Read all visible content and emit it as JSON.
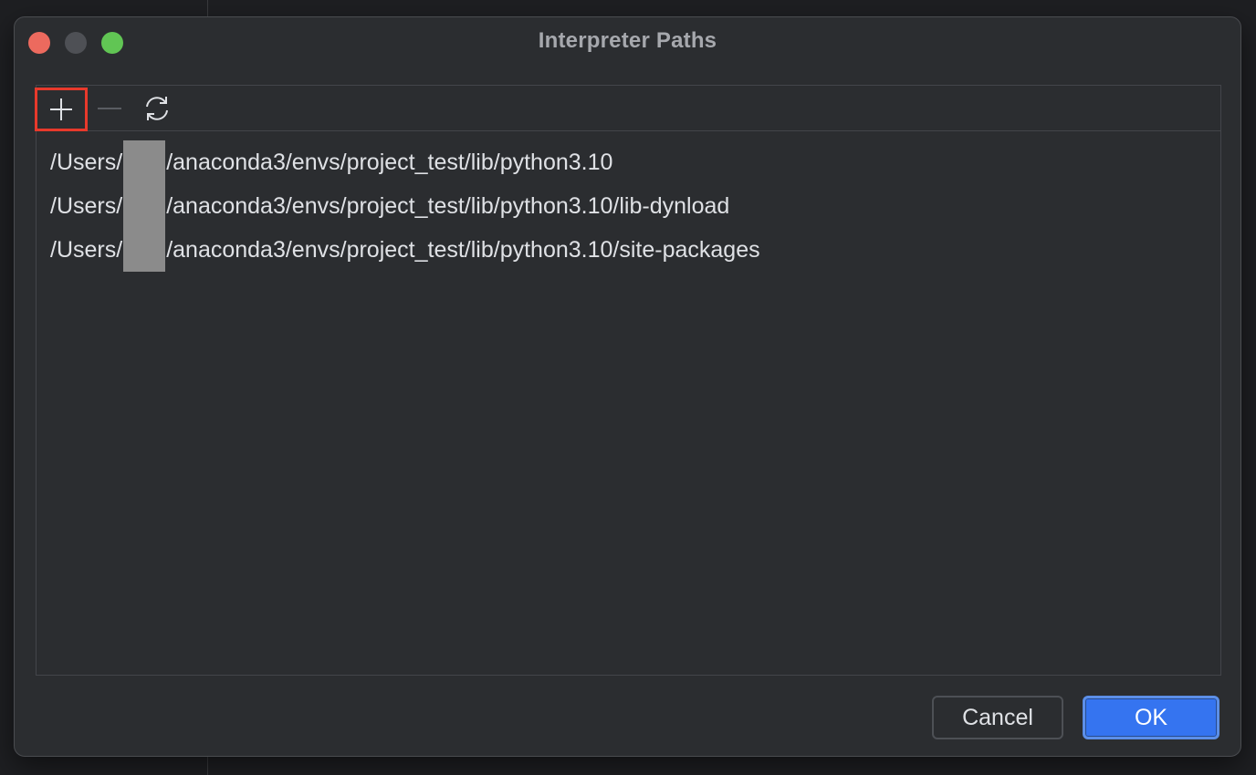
{
  "dialog": {
    "title": "Interpreter Paths"
  },
  "toolbar": {
    "add_icon": "plus-icon",
    "remove_icon": "minus-icon",
    "reload_icon": "reload-icon",
    "highlight_color": "#e8392b"
  },
  "paths": [
    {
      "prefix": "/Users/",
      "suffix": "/anaconda3/envs/project_test/lib/python3.10"
    },
    {
      "prefix": "/Users/",
      "suffix": "/anaconda3/envs/project_test/lib/python3.10/lib-dynload"
    },
    {
      "prefix": "/Users/",
      "suffix": "/anaconda3/envs/project_test/lib/python3.10/site-packages"
    }
  ],
  "buttons": {
    "cancel_label": "Cancel",
    "ok_label": "OK"
  },
  "colors": {
    "accent": "#3574f0",
    "close": "#ec6a5e",
    "zoom": "#61c554"
  }
}
